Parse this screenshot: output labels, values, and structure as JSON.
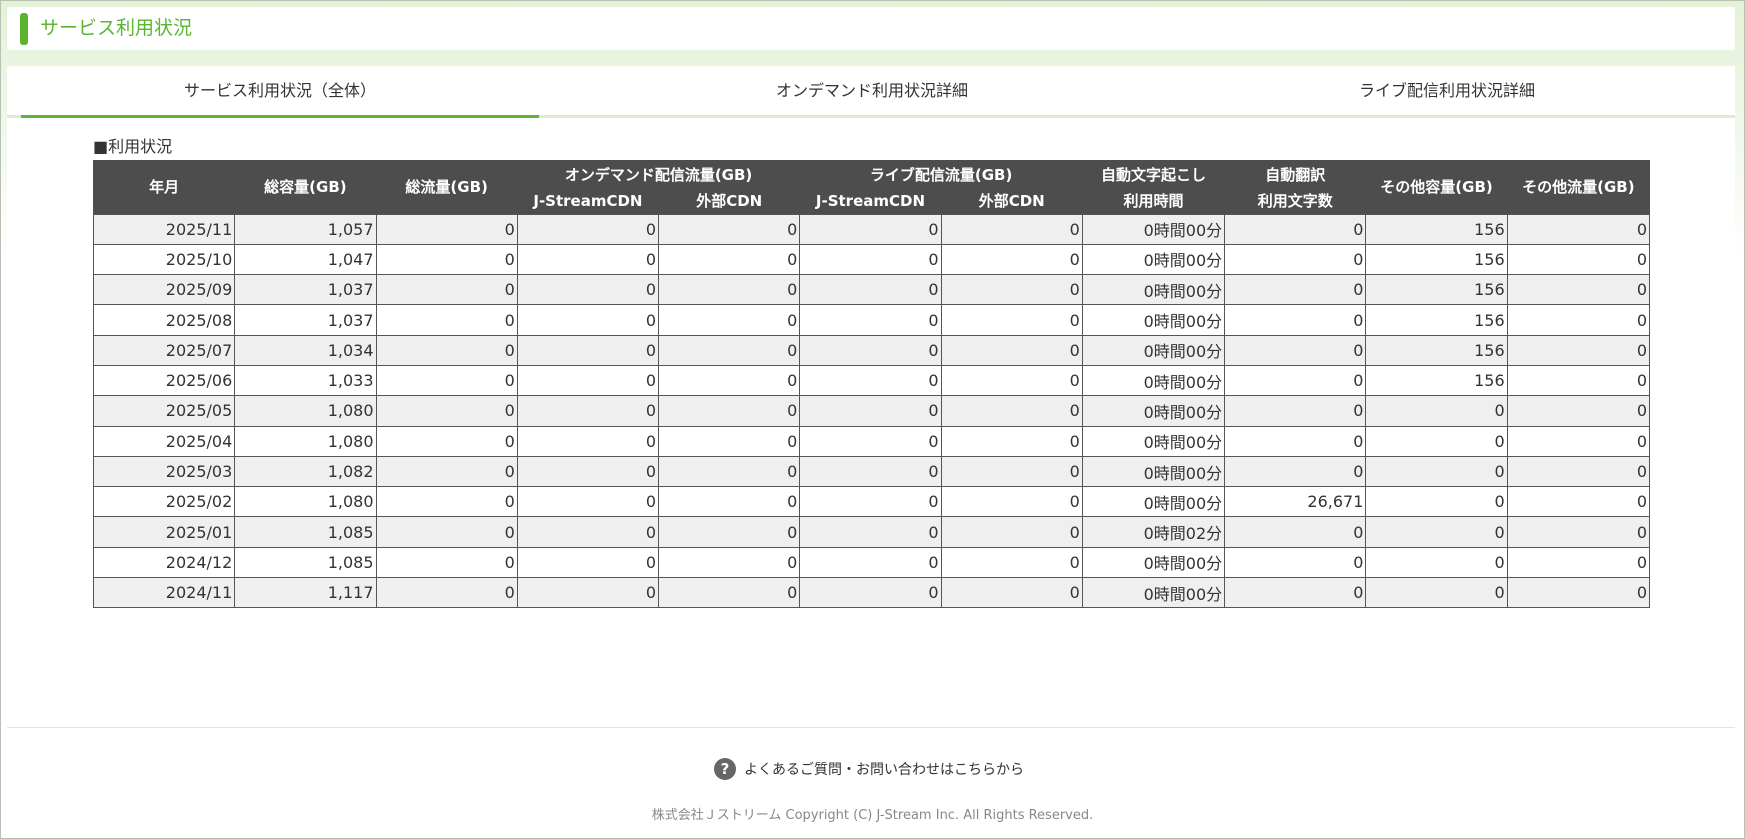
{
  "header": {
    "title": "サービス利用状況"
  },
  "tabs": [
    {
      "label": "サービス利用状況（全体）",
      "active": true
    },
    {
      "label": "オンデマンド利用状況詳細",
      "active": false
    },
    {
      "label": "ライブ配信利用状況詳細",
      "active": false
    }
  ],
  "section": {
    "label": "■利用状況"
  },
  "table": {
    "headers": {
      "month": "年月",
      "total_capacity": "総容量(GB)",
      "total_traffic": "総流量(GB)",
      "ondemand": "オンデマンド配信流量(GB)",
      "live": "ライブ配信流量(GB)",
      "transcription_line1": "自動文字起こし",
      "transcription_line2": "利用時間",
      "translation_line1": "自動翻訳",
      "translation_line2": "利用文字数",
      "other_capacity": "その他容量(GB)",
      "other_traffic": "その他流量(GB)",
      "jstream_cdn": "J-StreamCDN",
      "external_cdn": "外部CDN"
    },
    "rows": [
      [
        "2025/11",
        "1,057",
        "0",
        "0",
        "0",
        "0",
        "0",
        "0時間00分",
        "0",
        "156",
        "0"
      ],
      [
        "2025/10",
        "1,047",
        "0",
        "0",
        "0",
        "0",
        "0",
        "0時間00分",
        "0",
        "156",
        "0"
      ],
      [
        "2025/09",
        "1,037",
        "0",
        "0",
        "0",
        "0",
        "0",
        "0時間00分",
        "0",
        "156",
        "0"
      ],
      [
        "2025/08",
        "1,037",
        "0",
        "0",
        "0",
        "0",
        "0",
        "0時間00分",
        "0",
        "156",
        "0"
      ],
      [
        "2025/07",
        "1,034",
        "0",
        "0",
        "0",
        "0",
        "0",
        "0時間00分",
        "0",
        "156",
        "0"
      ],
      [
        "2025/06",
        "1,033",
        "0",
        "0",
        "0",
        "0",
        "0",
        "0時間00分",
        "0",
        "156",
        "0"
      ],
      [
        "2025/05",
        "1,080",
        "0",
        "0",
        "0",
        "0",
        "0",
        "0時間00分",
        "0",
        "0",
        "0"
      ],
      [
        "2025/04",
        "1,080",
        "0",
        "0",
        "0",
        "0",
        "0",
        "0時間00分",
        "0",
        "0",
        "0"
      ],
      [
        "2025/03",
        "1,082",
        "0",
        "0",
        "0",
        "0",
        "0",
        "0時間00分",
        "0",
        "0",
        "0"
      ],
      [
        "2025/02",
        "1,080",
        "0",
        "0",
        "0",
        "0",
        "0",
        "0時間00分",
        "26,671",
        "0",
        "0"
      ],
      [
        "2025/01",
        "1,085",
        "0",
        "0",
        "0",
        "0",
        "0",
        "0時間02分",
        "0",
        "0",
        "0"
      ],
      [
        "2024/12",
        "1,085",
        "0",
        "0",
        "0",
        "0",
        "0",
        "0時間00分",
        "0",
        "0",
        "0"
      ],
      [
        "2024/11",
        "1,117",
        "0",
        "0",
        "0",
        "0",
        "0",
        "0時間00分",
        "0",
        "0",
        "0"
      ]
    ]
  },
  "footer": {
    "help_icon": "question-circle-icon",
    "help_text": "よくあるご質問・お問い合わせはこちらから",
    "copyright": "株式会社Ｊストリーム Copyright (C) J-Stream Inc. All Rights Reserved."
  },
  "colors": {
    "accent": "#5cb531",
    "header_bg": "#4d4d4d",
    "row_alt": "#efefef"
  }
}
